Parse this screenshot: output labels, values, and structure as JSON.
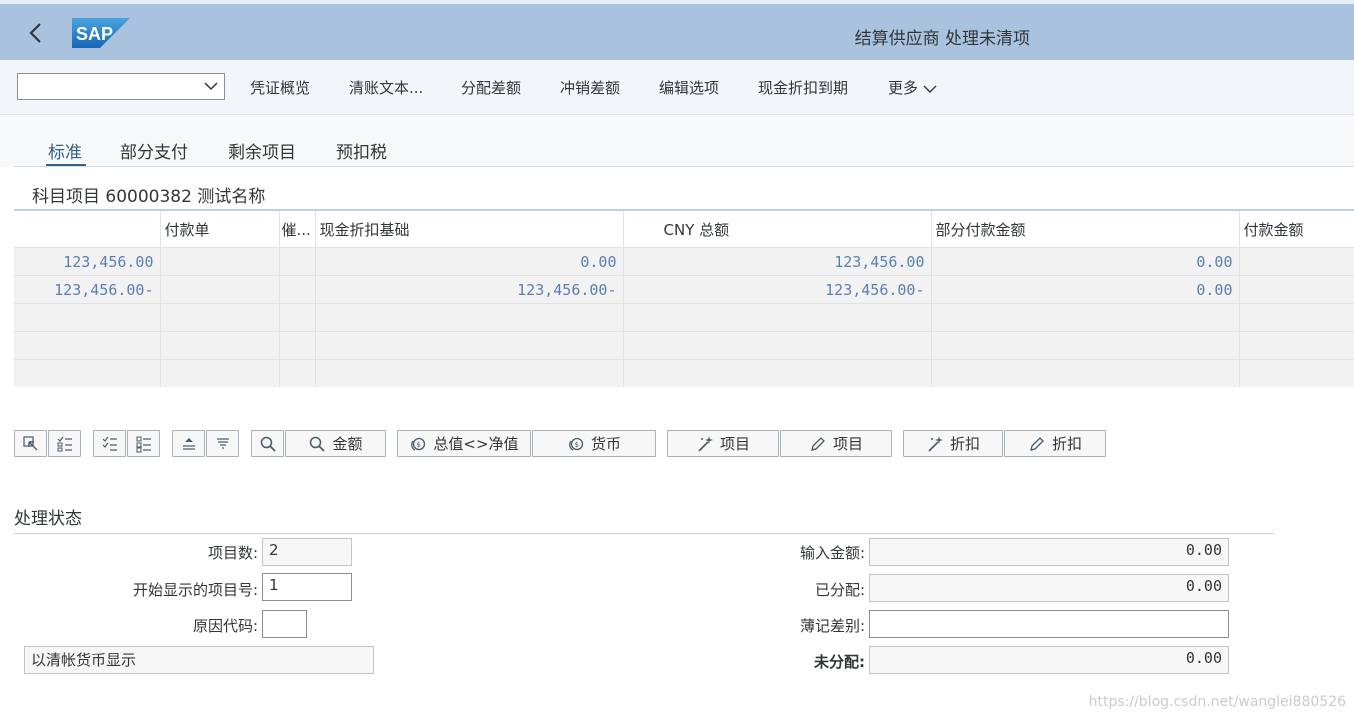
{
  "app": {
    "title": "结算供应商 处理未清项",
    "logo_text": "SAP"
  },
  "toolbar": {
    "combo_value": "",
    "buttons": [
      "凭证概览",
      "清账文本...",
      "分配差额",
      "冲销差额",
      "编辑选项",
      "现金折扣到期",
      "更多"
    ]
  },
  "tabs": [
    "标准",
    "部分支付",
    "剩余项目",
    "预扣税"
  ],
  "section": {
    "title": "科目项目 60000382 测试名称"
  },
  "grid": {
    "columns": [
      "",
      "付款单",
      "催...",
      "现金折扣基础",
      "CNY 总额",
      "部分付款金额",
      "付款金额"
    ],
    "rows": [
      [
        "123,456.00",
        "",
        "",
        "0.00",
        "123,456.00",
        "0.00",
        ""
      ],
      [
        "123,456.00-",
        "",
        "",
        "123,456.00-",
        "123,456.00-",
        "0.00",
        ""
      ],
      [
        "",
        "",
        "",
        "",
        "",
        "",
        ""
      ],
      [
        "",
        "",
        "",
        "",
        "",
        "",
        ""
      ],
      [
        "",
        "",
        "",
        "",
        "",
        "",
        ""
      ]
    ]
  },
  "actions": {
    "amount": "金额",
    "gross_net": "总值<>净值",
    "currency": "货币",
    "item_a": "项目",
    "item_b": "项目",
    "discount_a": "折扣",
    "discount_b": "折扣"
  },
  "status": {
    "title": "处理状态",
    "items_count_label": "项目数:",
    "items_count": "2",
    "first_item_label": "开始显示的项目号:",
    "first_item": "1",
    "reason_code_label": "原因代码:",
    "reason_code": "",
    "currency_display": "以清帐货币显示",
    "input_amount_label": "输入金额:",
    "input_amount": "0.00",
    "assigned_label": "已分配:",
    "assigned": "0.00",
    "diff_label": "薄记差别:",
    "diff": "",
    "unassigned_label": "未分配:",
    "unassigned": "0.00"
  },
  "watermark": "https://blog.csdn.net/wanglei880526"
}
